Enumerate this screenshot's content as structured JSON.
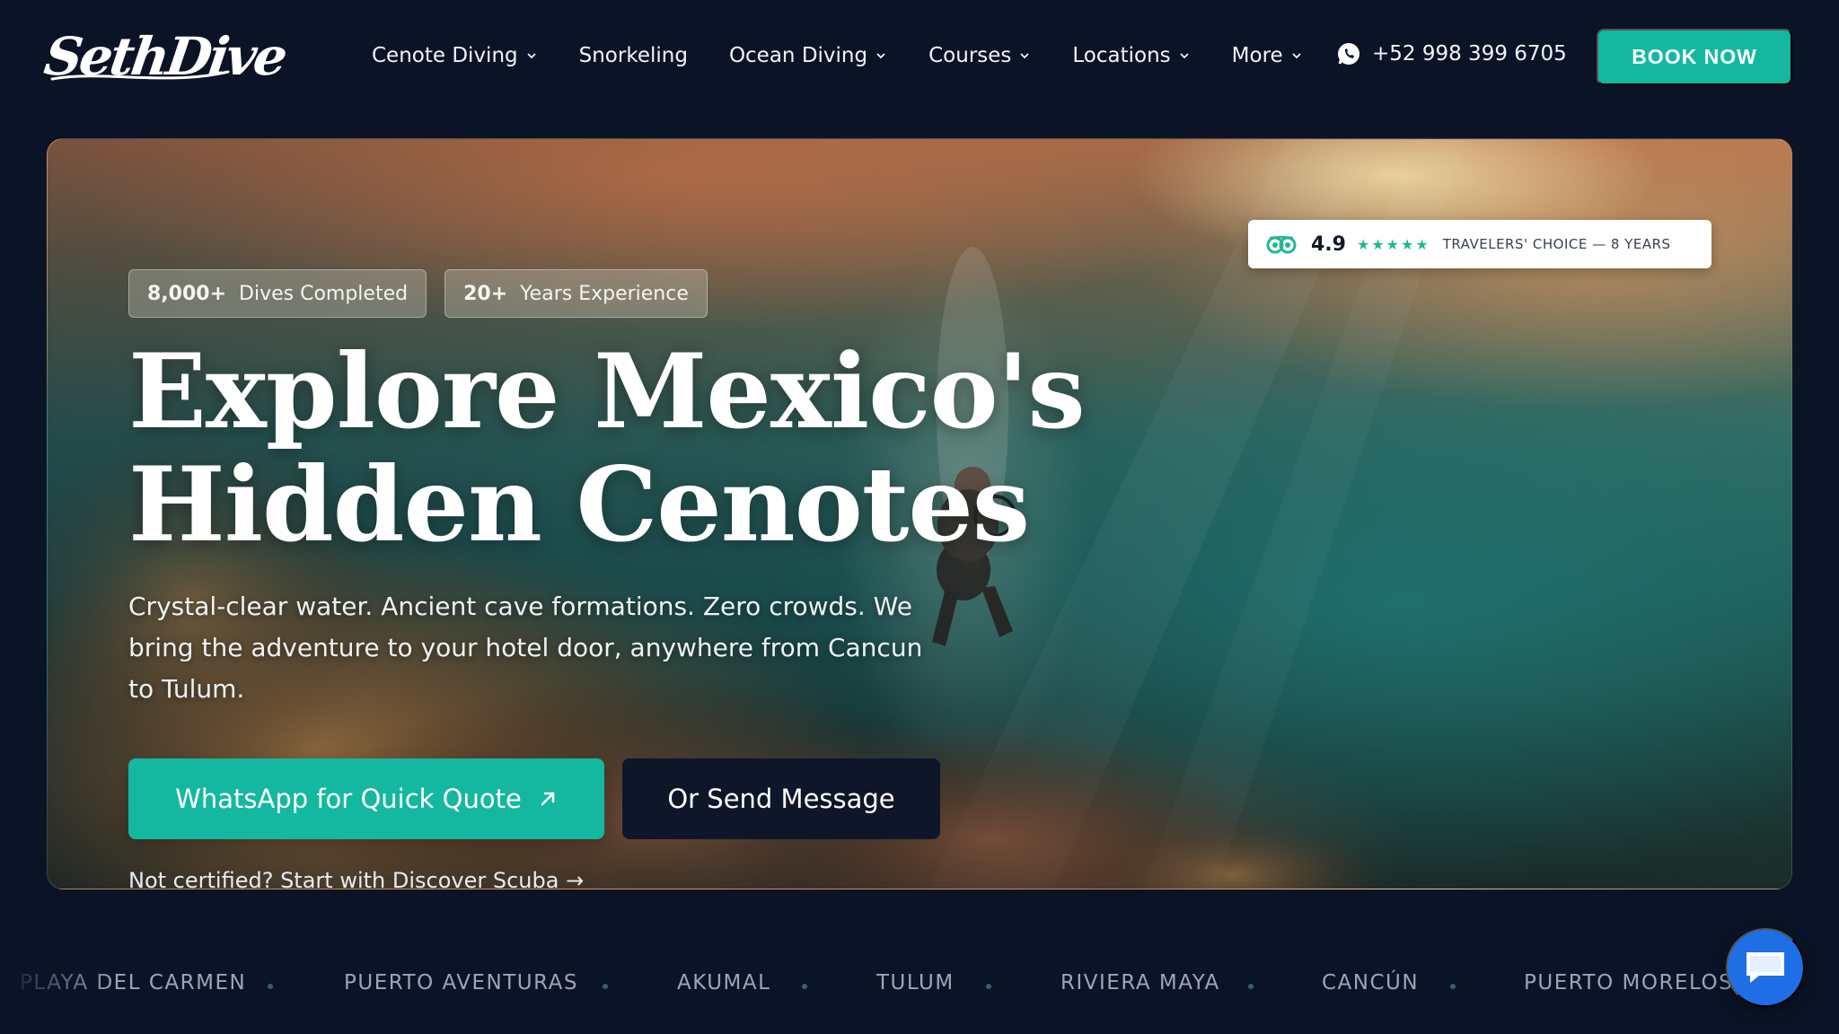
{
  "brand": {
    "logo_text": "SethDive"
  },
  "nav": {
    "items": [
      {
        "label": "Cenote Diving",
        "dropdown": true
      },
      {
        "label": "Snorkeling",
        "dropdown": false
      },
      {
        "label": "Ocean Diving",
        "dropdown": true
      },
      {
        "label": "Courses",
        "dropdown": true
      },
      {
        "label": "Locations",
        "dropdown": true
      },
      {
        "label": "More",
        "dropdown": true
      }
    ],
    "phone": "+52 998 399 6705",
    "book_label": "BOOK NOW"
  },
  "hero": {
    "stats": [
      {
        "value": "8,000+",
        "label": "Dives Completed"
      },
      {
        "value": "20+",
        "label": "Years Experience"
      }
    ],
    "rating": {
      "value": "4.9",
      "stars": "★★★★★",
      "label": "TRAVELERS' CHOICE — 8 YEARS"
    },
    "title_line1": "Explore Mexico's",
    "title_line2": "Hidden Cenotes",
    "subtitle": "Crystal-clear water. Ancient cave formations. Zero crowds. We bring the adventure to your hotel door, anywhere from Cancun to Tulum.",
    "cta_primary": "WhatsApp for Quick Quote",
    "cta_secondary": "Or Send Message",
    "discover_link": "Not certified? Start with Discover Scuba →"
  },
  "locations": [
    "PLAYA DEL CARMEN",
    "PUERTO AVENTURAS",
    "AKUMAL",
    "TULUM",
    "RIVIERA MAYA",
    "CANCÚN",
    "PUERTO MORELOS"
  ],
  "colors": {
    "accent": "#14b8a0",
    "background": "#0b1426",
    "chat": "#1e6fe6",
    "rating_green": "#1fb894"
  },
  "icons": {
    "chevron": "chevron-down-icon",
    "phone": "whatsapp-icon",
    "cta_arrow": "arrow-up-right-icon",
    "rating": "tripadvisor-owl-icon",
    "chat": "chat-icon"
  }
}
